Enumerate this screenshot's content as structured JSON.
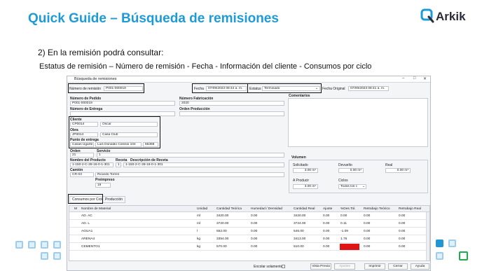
{
  "slide": {
    "title": "Quick Guide – Búsqueda de remisiones",
    "logo": "Arkik",
    "step": "2)   En la remisión podrá consultar:",
    "subtitle": "Estatus de remisión – Número de remisión - Fecha - Información del cliente - Consumos por ciclo"
  },
  "window": {
    "title": "Búsqueda de remisiones",
    "controls": [
      "–",
      "□",
      "✕"
    ],
    "numero_remision_label": "Número de remisión",
    "numero_remision_value": "P001-000019",
    "fecha_label": "Fecha",
    "fecha_value": "07/09/2023 08:44 a. m.",
    "estatus_label": "Estatus",
    "estatus_value": "Terminado",
    "fecha_original_label": "Fecha Original",
    "fecha_original_value": "07/09/2023 08:41 a. m.",
    "numero_pedido_label": "Número de Pedido",
    "numero_pedido_value": "P001-000019",
    "numero_fabricacion_label": "Número Fabricación",
    "numero_fabricacion_value": "2020",
    "comentarios_label": "Comentarios",
    "numero_entrega_label": "Número de Entrega",
    "orden_produccion_label": "Orden Producción",
    "cliente_label": "Cliente",
    "cliente_code": "CP0014",
    "cliente_name": "Oscar",
    "obra_label": "Obra",
    "obra_code": "JP0014",
    "obra_name": "Casa Club",
    "punto_label": "Punto de entrega",
    "punto_1": "Casas Ugarte",
    "punto_2": "Luis Donaldo Colosio 104",
    "punto_3": "66369",
    "orden_label": "Orden",
    "orden_value": "21",
    "servicio_label": "Servicio",
    "servicio_value": "1",
    "producto_label": "Nombre del Producto",
    "producto_value": "1-150-2-C-28-16-0-1-301",
    "receta_label": "Receta",
    "receta_value": "1",
    "desc_receta_label": "Descripción de Receta",
    "desc_receta_value": "1-150-2-C-28-16-0-1-301",
    "camion_label": "Camión",
    "camion_code": "CR-03",
    "camion_name": "Ricardo Torres",
    "preimpreso_label": "Preimpreso",
    "preimpreso_value": "19",
    "volumen_label": "Volumen",
    "solicitado_label": "Solicitado",
    "solicitado_value": "3.00 m³",
    "devuelto_label": "Devuelto",
    "devuelto_value": "0.00 m³",
    "real_label": "Real",
    "real_value": "0.00 m³",
    "a_producir_label": "A Producir",
    "a_producir_value": "3.00 m³",
    "ciclos_label": "Ciclos",
    "ciclos_value": "Todos los c",
    "tabs": [
      "Consumos por Ciclo",
      "Producción"
    ],
    "columns": [
      "M",
      "Nombre de Material",
      "Unidad",
      "Cantidad Teórica",
      "Humedad / Densidad",
      "Cantidad Real",
      "Ajuste",
      "%Des.Tol.",
      "Retrabajo Teórico",
      "Retrabajo Real"
    ],
    "rows": [
      [
        "",
        "AD. AC",
        "ml",
        "3420.00",
        "0.00",
        "3420.00",
        "0.00",
        "0.00",
        "0.00",
        "0.00"
      ],
      [
        "",
        "AD. L",
        "ml",
        "3720.00",
        "0.00",
        "3724.00",
        "0.00",
        "0.11",
        "0.00",
        "0.00"
      ],
      [
        "",
        "AGUA1",
        "l",
        "552.00",
        "0.00",
        "546.00",
        "0.00",
        "-1.09",
        "0.00",
        "0.00"
      ],
      [
        "",
        "ARENA4",
        "kg",
        "3354.00",
        "0.00",
        "3413.00",
        "0.00",
        "1.76",
        "0.00",
        "0.00"
      ],
      [
        "",
        "CEMENTO1",
        "kg",
        "570.00",
        "0.00",
        "510.00",
        "0.00",
        "",
        "0.00",
        "0.00"
      ]
    ],
    "error_cell_color": "#e01414",
    "encolar_label": "Encolar solamente",
    "buttons": [
      "Vista Previa",
      "Ajustes",
      "Imprimir",
      "Cerrar",
      "Ayuda"
    ]
  },
  "colors": {
    "title": "#1e9bd7",
    "accent_blue": "#2196d3",
    "accent_green": "#1faa4b"
  }
}
